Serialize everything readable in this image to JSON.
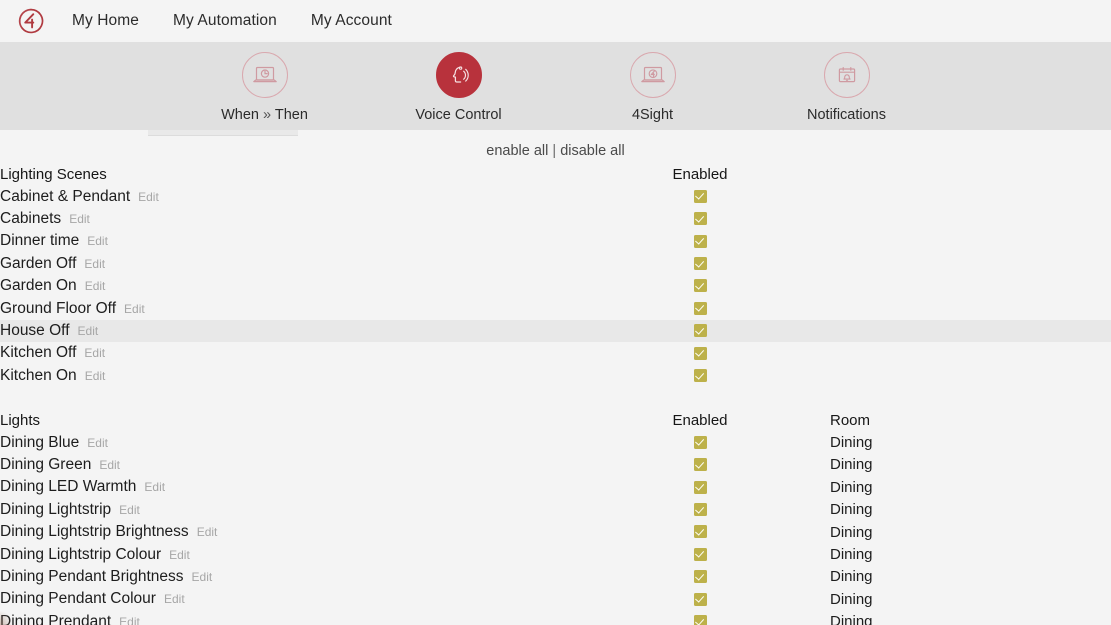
{
  "brand": {
    "logo_icon": "control4-logo-icon",
    "accent": "#b8323c",
    "band_bg": "#e0e0e0",
    "checkbox_color": "#bdb14a"
  },
  "topnav": {
    "links": [
      {
        "label": "My Home"
      },
      {
        "label": "My Automation"
      },
      {
        "label": "My Account"
      }
    ]
  },
  "toolbar": {
    "items": [
      {
        "label_before": "When",
        "chevron": "»",
        "label_after": "Then",
        "label": "When » Then",
        "icon": "laptop-clock-icon",
        "active": false
      },
      {
        "label": "Voice Control",
        "icon": "voice-speaking-icon",
        "active": true
      },
      {
        "label": "4Sight",
        "icon": "laptop-control4-icon",
        "active": false
      },
      {
        "label": "Notifications",
        "icon": "calendar-bell-icon",
        "active": false
      }
    ]
  },
  "bulk_actions": {
    "enable_all": "enable all",
    "separator": "|",
    "disable_all": "disable all"
  },
  "scenes_section": {
    "title": "Lighting Scenes",
    "enabled_header": "Enabled",
    "edit_label": "Edit",
    "rows": [
      {
        "name": "Cabinet & Pendant",
        "enabled": true,
        "highlighted": false
      },
      {
        "name": "Cabinets",
        "enabled": true,
        "highlighted": false
      },
      {
        "name": "Dinner time",
        "enabled": true,
        "highlighted": false
      },
      {
        "name": "Garden Off",
        "enabled": true,
        "highlighted": false
      },
      {
        "name": "Garden On",
        "enabled": true,
        "highlighted": false
      },
      {
        "name": "Ground Floor Off",
        "enabled": true,
        "highlighted": false
      },
      {
        "name": "House Off",
        "enabled": true,
        "highlighted": true
      },
      {
        "name": "Kitchen Off",
        "enabled": true,
        "highlighted": false
      },
      {
        "name": "Kitchen On",
        "enabled": true,
        "highlighted": false
      }
    ]
  },
  "lights_section": {
    "title": "Lights",
    "enabled_header": "Enabled",
    "room_header": "Room",
    "edit_label": "Edit",
    "rows": [
      {
        "name": "Dining Blue",
        "enabled": true,
        "room": "Dining"
      },
      {
        "name": "Dining Green",
        "enabled": true,
        "room": "Dining"
      },
      {
        "name": "Dining LED Warmth",
        "enabled": true,
        "room": "Dining"
      },
      {
        "name": "Dining Lightstrip",
        "enabled": true,
        "room": "Dining"
      },
      {
        "name": "Dining Lightstrip Brightness",
        "enabled": true,
        "room": "Dining"
      },
      {
        "name": "Dining Lightstrip Colour",
        "enabled": true,
        "room": "Dining"
      },
      {
        "name": "Dining Pendant Brightness",
        "enabled": true,
        "room": "Dining"
      },
      {
        "name": "Dining Pendant Colour",
        "enabled": true,
        "room": "Dining"
      },
      {
        "name": "Dining Prendant",
        "enabled": true,
        "room": "Dining"
      }
    ]
  }
}
